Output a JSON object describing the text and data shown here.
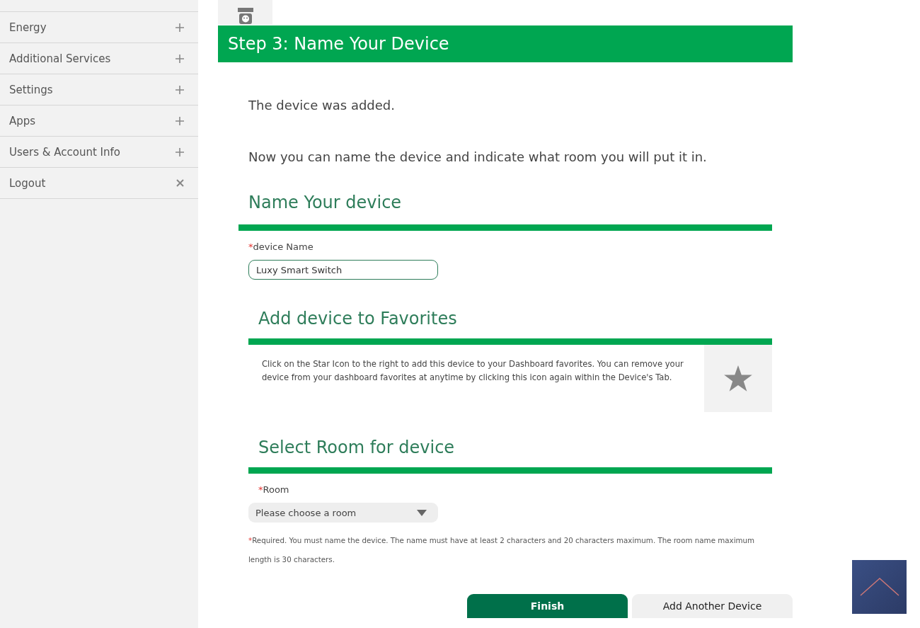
{
  "sidebar": {
    "items": [
      {
        "label": "Energy",
        "kind": "expandable"
      },
      {
        "label": "Additional Services",
        "kind": "expandable"
      },
      {
        "label": "Settings",
        "kind": "expandable"
      },
      {
        "label": "Apps",
        "kind": "expandable"
      },
      {
        "label": "Users & Account Info",
        "kind": "expandable"
      },
      {
        "label": "Logout",
        "kind": "action"
      }
    ]
  },
  "step_header": "Step 3: Name Your Device",
  "messages": [
    "The device was added.",
    "Now you can name the device and indicate what room you will put it in."
  ],
  "name_section": {
    "title": "Name Your device",
    "field": {
      "required_mark": "*",
      "label": "device Name",
      "value": "Luxy Smart Switch"
    }
  },
  "favorites_section": {
    "title": "Add device to Favorites",
    "text": "Click on the Star Icon to the right to add this device to your Dashboard favorites. You can remove your device from your dashboard favorites at anytime by clicking this icon again within the Device's Tab.",
    "starred": false
  },
  "room_section": {
    "title": "Select Room for device",
    "field": {
      "required_mark": "*",
      "label": "Room",
      "placeholder": "Please choose a room"
    }
  },
  "note": {
    "required_mark": "*",
    "text": "Required. You must name the device. The name must have at least 2 characters and 20 characters maximum. The room name maximum length is 30 characters."
  },
  "buttons": [
    {
      "label": "Finish",
      "kind": "primary"
    },
    {
      "label": "Add Another Device",
      "kind": "secondary"
    }
  ]
}
